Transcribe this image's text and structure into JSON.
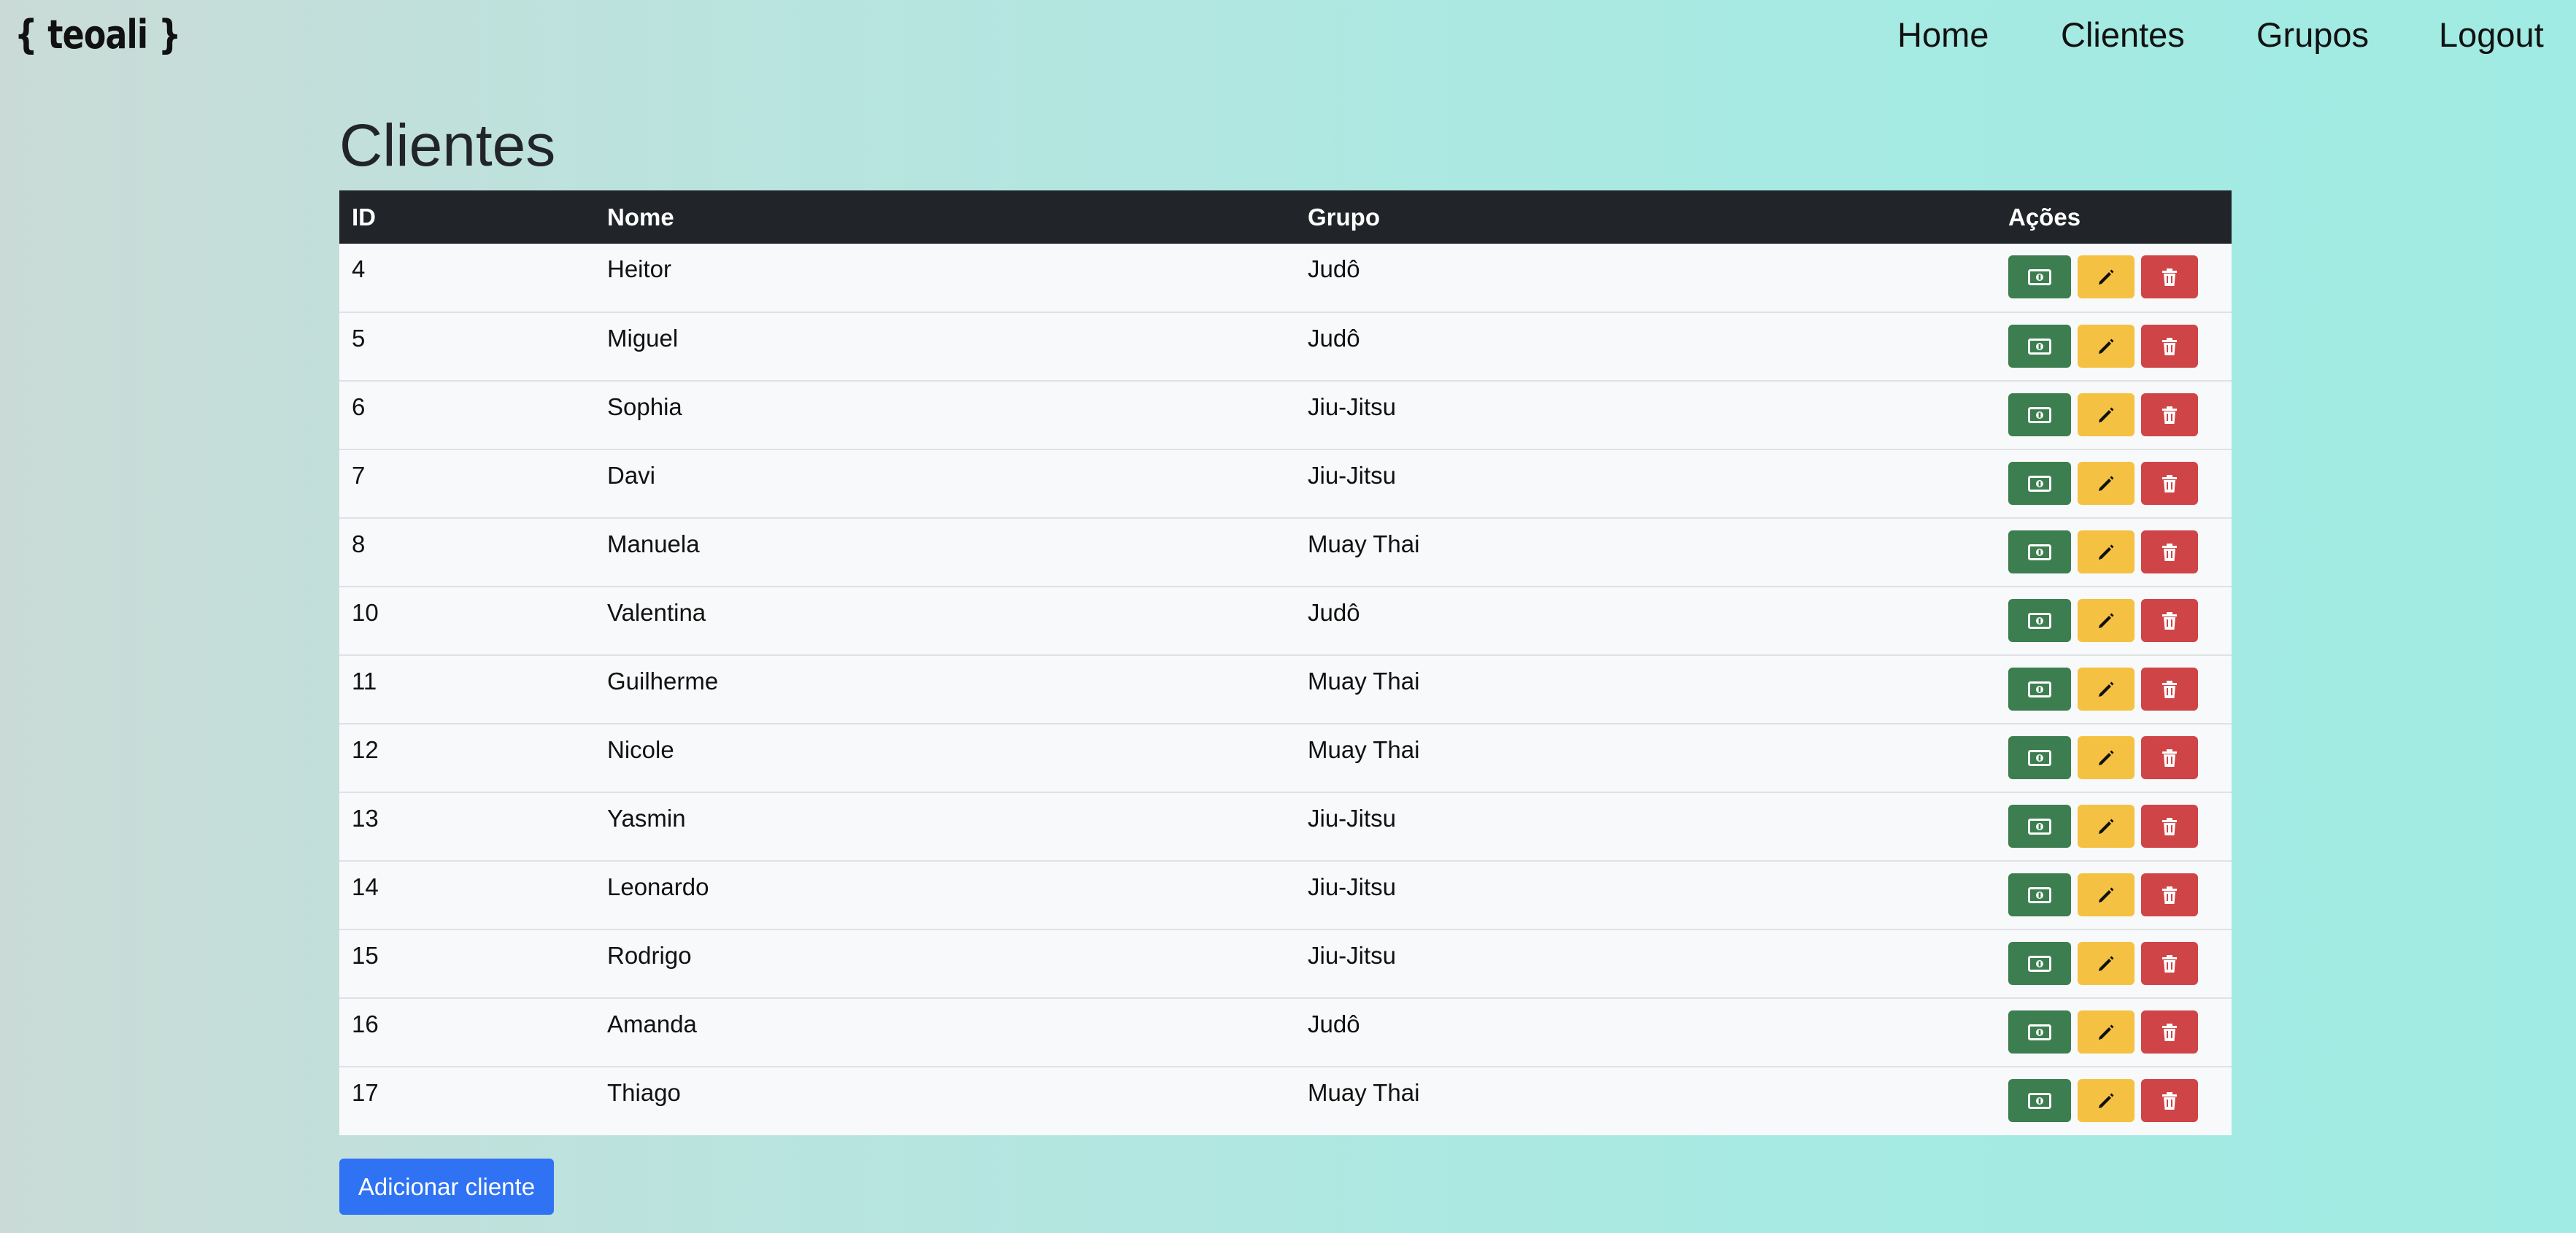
{
  "brand": "{ teoali }",
  "nav": {
    "items": [
      {
        "label": "Home"
      },
      {
        "label": "Clientes"
      },
      {
        "label": "Grupos"
      },
      {
        "label": "Logout"
      }
    ]
  },
  "page_title": "Clientes",
  "table": {
    "headers": {
      "id": "ID",
      "nome": "Nome",
      "grupo": "Grupo",
      "acoes": "Ações"
    },
    "rows": [
      {
        "id": "4",
        "nome": "Heitor",
        "grupo": "Judô"
      },
      {
        "id": "5",
        "nome": "Miguel",
        "grupo": "Judô"
      },
      {
        "id": "6",
        "nome": "Sophia",
        "grupo": "Jiu-Jitsu"
      },
      {
        "id": "7",
        "nome": "Davi",
        "grupo": "Jiu-Jitsu"
      },
      {
        "id": "8",
        "nome": "Manuela",
        "grupo": "Muay Thai"
      },
      {
        "id": "10",
        "nome": "Valentina",
        "grupo": "Judô"
      },
      {
        "id": "11",
        "nome": "Guilherme",
        "grupo": "Muay Thai"
      },
      {
        "id": "12",
        "nome": "Nicole",
        "grupo": "Muay Thai"
      },
      {
        "id": "13",
        "nome": "Yasmin",
        "grupo": "Jiu-Jitsu"
      },
      {
        "id": "14",
        "nome": "Leonardo",
        "grupo": "Jiu-Jitsu"
      },
      {
        "id": "15",
        "nome": "Rodrigo",
        "grupo": "Jiu-Jitsu"
      },
      {
        "id": "16",
        "nome": "Amanda",
        "grupo": "Judô"
      },
      {
        "id": "17",
        "nome": "Thiago",
        "grupo": "Muay Thai"
      }
    ],
    "row_actions": [
      {
        "icon": "money-bill-icon",
        "color": "#3d7e50"
      },
      {
        "icon": "pencil-icon",
        "color": "#f5c142"
      },
      {
        "icon": "trash-icon",
        "color": "#cf4446"
      }
    ]
  },
  "add_button_label": "Adicionar cliente",
  "colors": {
    "header_bg": "#212529",
    "primary": "#2f73f4",
    "success": "#3d7e50",
    "warning": "#f5c142",
    "danger": "#cf4446"
  }
}
